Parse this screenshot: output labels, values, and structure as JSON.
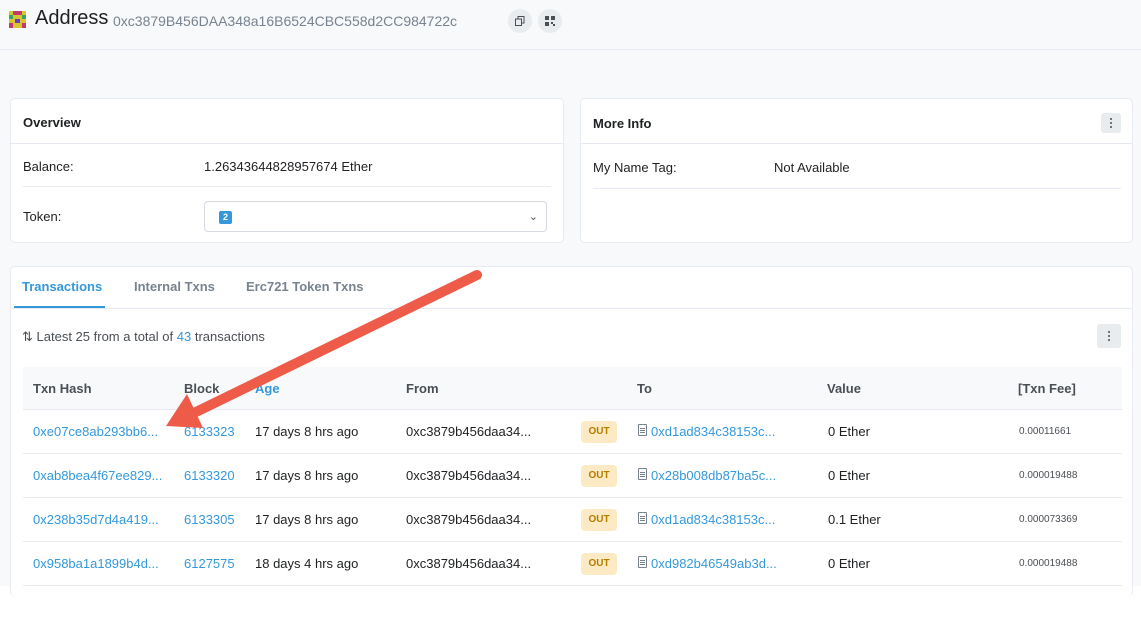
{
  "header": {
    "title": "Address",
    "address": "0xc3879B456DAA348a16B6524CBC558d2CC984722c",
    "copy_icon": "copy-icon",
    "qr_icon": "qr-code-icon"
  },
  "overview": {
    "title": "Overview",
    "balance_label": "Balance:",
    "balance_value": "1.26343644828957674 Ether",
    "token_label": "Token:",
    "token_count": "2"
  },
  "more_info": {
    "title": "More Info",
    "name_tag_label": "My Name Tag:",
    "name_tag_value": "Not Available"
  },
  "tabs": [
    {
      "label": "Transactions"
    },
    {
      "label": "Internal Txns"
    },
    {
      "label": "Erc721 Token Txns"
    }
  ],
  "summary": {
    "prefix": "Latest 25 from a total of",
    "count": "43",
    "suffix": "transactions"
  },
  "table": {
    "headers": {
      "hash": "Txn Hash",
      "block": "Block",
      "age": "Age",
      "from": "From",
      "to": "To",
      "value": "Value",
      "fee": "[Txn Fee]"
    },
    "rows": [
      {
        "hash": "0xe07ce8ab293bb6...",
        "block": "6133323",
        "age": "17 days 8 hrs ago",
        "from": "0xc3879b456daa34...",
        "direction": "OUT",
        "to": "0xd1ad834c38153c...",
        "value": "0 Ether",
        "fee": "0.00011661"
      },
      {
        "hash": "0xab8bea4f67ee829...",
        "block": "6133320",
        "age": "17 days 8 hrs ago",
        "from": "0xc3879b456daa34...",
        "direction": "OUT",
        "to": "0x28b008db87ba5c...",
        "value": "0 Ether",
        "fee": "0.000019488"
      },
      {
        "hash": "0x238b35d7d4a419...",
        "block": "6133305",
        "age": "17 days 8 hrs ago",
        "from": "0xc3879b456daa34...",
        "direction": "OUT",
        "to": "0xd1ad834c38153c...",
        "value": "0.1 Ether",
        "fee": "0.000073369"
      },
      {
        "hash": "0x958ba1a1899b4d...",
        "block": "6127575",
        "age": "18 days 4 hrs ago",
        "from": "0xc3879b456daa34...",
        "direction": "OUT",
        "to": "0xd982b46549ab3d...",
        "value": "0 Ether",
        "fee": "0.000019488"
      }
    ]
  },
  "colors": {
    "accent": "#3498db",
    "out_badge_bg": "#fbeac4",
    "arrow": "#ef5b49"
  }
}
